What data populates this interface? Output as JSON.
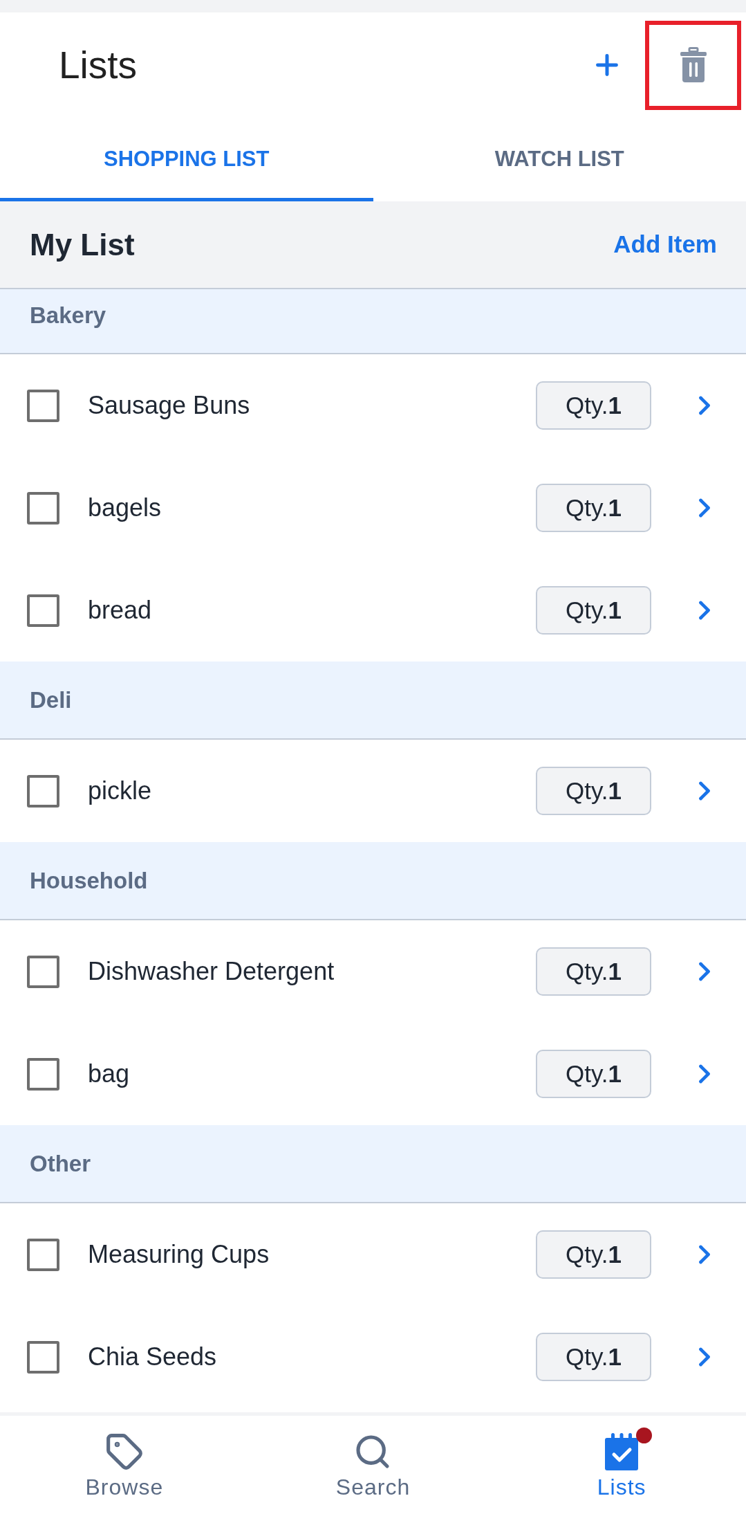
{
  "header": {
    "title": "Lists",
    "actions": [
      {
        "kind": "add",
        "highlighted": false
      },
      {
        "kind": "delete",
        "highlighted": true
      }
    ]
  },
  "tabs": [
    {
      "label": "SHOPPING LIST",
      "selected": true
    },
    {
      "label": "WATCH LIST",
      "selected": false
    }
  ],
  "list": {
    "title": "My List",
    "action": "Add Item"
  },
  "categories": [
    {
      "name": "Bakery",
      "items": [
        {
          "name": "Sausage Buns",
          "checked": false,
          "qty": "Qty.**1**"
        },
        {
          "name": "bagels",
          "checked": false,
          "qty": "Qty.**1**"
        },
        {
          "name": "bread",
          "checked": false,
          "qty": "Qty.**1**"
        }
      ]
    },
    {
      "name": "Deli",
      "items": [
        {
          "name": "pickle",
          "checked": false,
          "qty": "Qty.**1**"
        }
      ]
    },
    {
      "name": "Household",
      "items": [
        {
          "name": "Dishwasher Detergent",
          "checked": false,
          "qty": "Qty.**1**"
        },
        {
          "name": "bag",
          "checked": false,
          "qty": "Qty.**1**"
        }
      ]
    },
    {
      "name": "Other",
      "items": [
        {
          "name": "Measuring Cups",
          "checked": false,
          "qty": "Qty.**1**"
        },
        {
          "name": "Chia Seeds",
          "checked": false,
          "qty": "Qty.**1**"
        }
      ]
    }
  ],
  "bottom_nav": [
    {
      "kind": "tag",
      "label": "Browse",
      "selected": false,
      "alert": false
    },
    {
      "kind": "search",
      "label": "Search",
      "selected": false,
      "alert": false
    },
    {
      "kind": "lists",
      "label": "Lists",
      "selected": true,
      "alert": true
    }
  ]
}
